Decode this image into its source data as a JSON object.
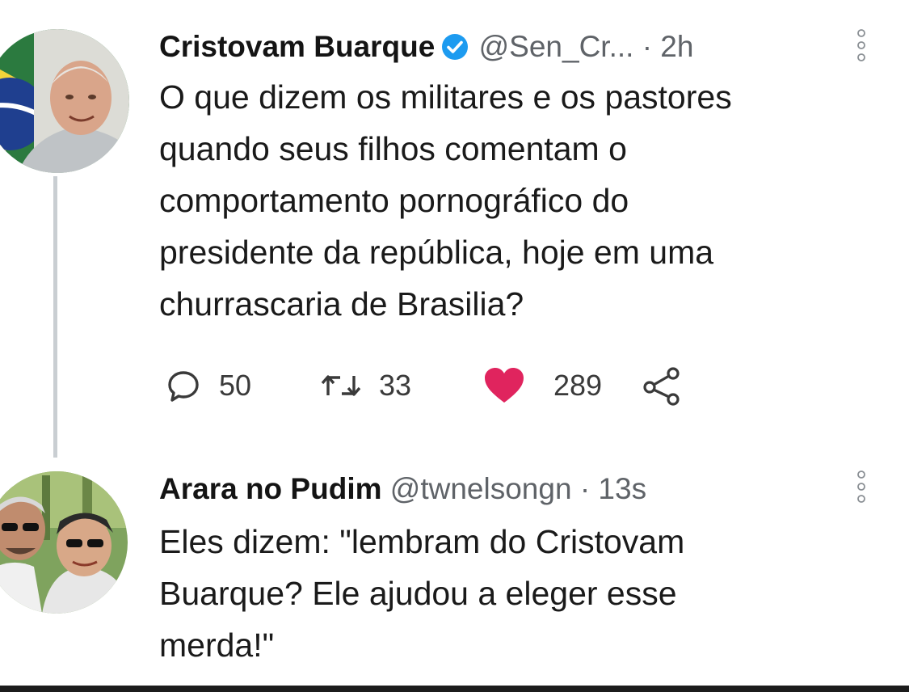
{
  "tweets": [
    {
      "name": "Cristovam Buarque",
      "handle": "@Sen_Cr...",
      "separator": "·",
      "time": "2h",
      "verified": true,
      "text": "O que dizem os militares e os pastores\nquando seus filhos comentam o\ncomportamento pornográfico do\npresidente da república, hoje em uma\nchurrascaria de Brasilia?",
      "replies": "50",
      "retweets": "33",
      "likes": "289",
      "liked": true
    },
    {
      "name": "Arara no Pudim",
      "handle": "@twnelsongn",
      "separator": "·",
      "time": "13s",
      "verified": false,
      "text": "Eles dizem: \"lembram do Cristovam\nBuarque? Ele ajudou a eleger esse\nmerda!\""
    }
  ],
  "icons": {
    "verified": "verified-badge-icon",
    "more": "more-vertical-icon",
    "reply": "reply-icon",
    "retweet": "retweet-icon",
    "like": "heart-icon",
    "share": "share-icon"
  },
  "colors": {
    "verified": "#1d9bf0",
    "like": "#e0245e",
    "secondary_text": "#5f6368",
    "thread_line": "#c9ced2"
  }
}
